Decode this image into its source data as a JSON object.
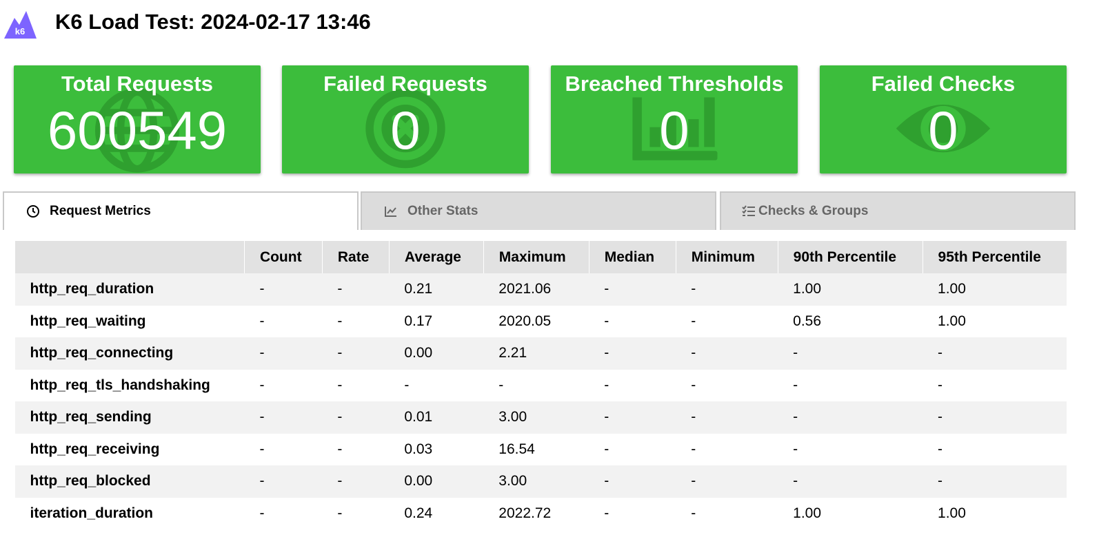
{
  "header": {
    "title": "K6 Load Test: 2024-02-17 13:46",
    "logo_text": "k6"
  },
  "colors": {
    "card_green": "#3cbd3c",
    "logo_purple": "#7d64ff"
  },
  "cards": [
    {
      "label": "Total Requests",
      "value": "600549",
      "icon": "globe-icon"
    },
    {
      "label": "Failed Requests",
      "value": "0",
      "icon": "x-circle-icon"
    },
    {
      "label": "Breached Thresholds",
      "value": "0",
      "icon": "bar-chart-icon"
    },
    {
      "label": "Failed Checks",
      "value": "0",
      "icon": "eye-icon"
    }
  ],
  "tabs": [
    {
      "label": "Request Metrics",
      "icon": "clock-icon",
      "active": true
    },
    {
      "label": "Other Stats",
      "icon": "line-chart-icon",
      "active": false
    },
    {
      "label": "Checks & Groups",
      "icon": "checklist-icon",
      "active": false
    }
  ],
  "table": {
    "columns": [
      "",
      "Count",
      "Rate",
      "Average",
      "Maximum",
      "Median",
      "Minimum",
      "90th Percentile",
      "95th Percentile"
    ],
    "rows": [
      [
        "http_req_duration",
        "-",
        "-",
        "0.21",
        "2021.06",
        "-",
        "-",
        "1.00",
        "1.00"
      ],
      [
        "http_req_waiting",
        "-",
        "-",
        "0.17",
        "2020.05",
        "-",
        "-",
        "0.56",
        "1.00"
      ],
      [
        "http_req_connecting",
        "-",
        "-",
        "0.00",
        "2.21",
        "-",
        "-",
        "-",
        "-"
      ],
      [
        "http_req_tls_handshaking",
        "-",
        "-",
        "-",
        "-",
        "-",
        "-",
        "-",
        "-"
      ],
      [
        "http_req_sending",
        "-",
        "-",
        "0.01",
        "3.00",
        "-",
        "-",
        "-",
        "-"
      ],
      [
        "http_req_receiving",
        "-",
        "-",
        "0.03",
        "16.54",
        "-",
        "-",
        "-",
        "-"
      ],
      [
        "http_req_blocked",
        "-",
        "-",
        "0.00",
        "3.00",
        "-",
        "-",
        "-",
        "-"
      ],
      [
        "iteration_duration",
        "-",
        "-",
        "0.24",
        "2022.72",
        "-",
        "-",
        "1.00",
        "1.00"
      ]
    ]
  }
}
